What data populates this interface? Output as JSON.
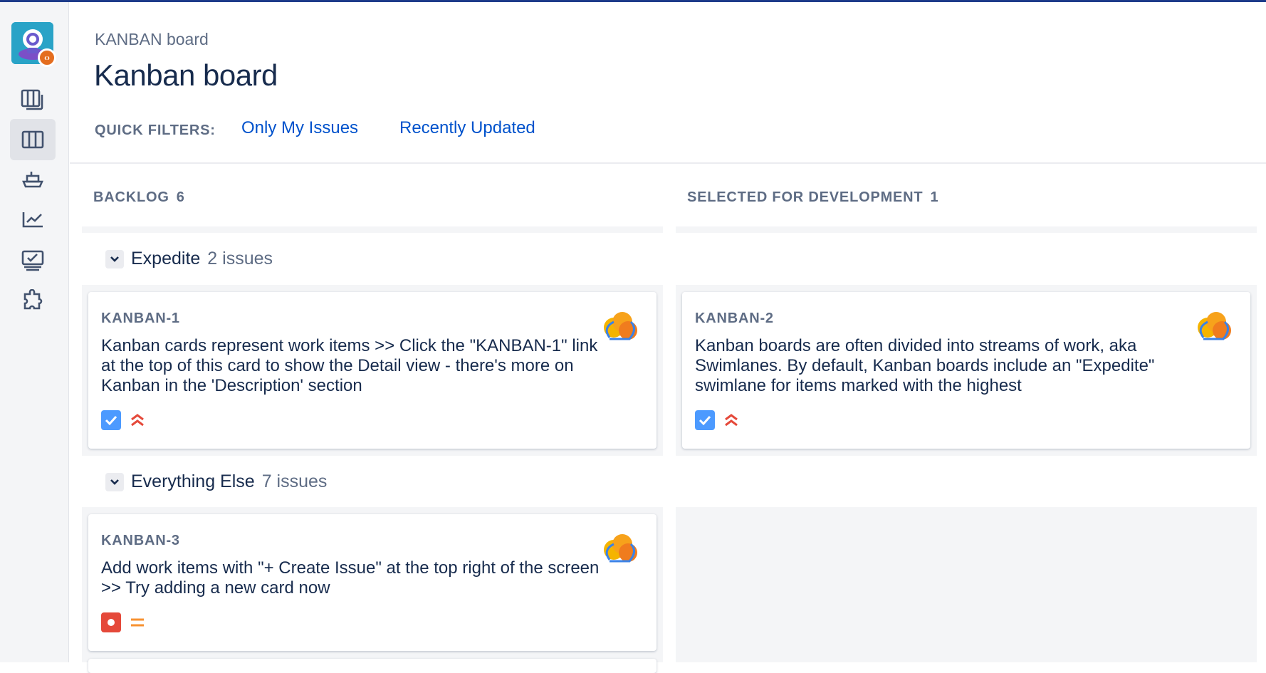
{
  "header": {
    "breadcrumb": "KANBAN board",
    "title": "Kanban board"
  },
  "quick_filters": {
    "label": "QUICK FILTERS:",
    "items": [
      "Only My Issues",
      "Recently Updated"
    ]
  },
  "sidebar": {
    "items": [
      {
        "icon": "project-avatar-icon"
      },
      {
        "icon": "backlog-icon"
      },
      {
        "icon": "board-icon",
        "active": true
      },
      {
        "icon": "releases-icon"
      },
      {
        "icon": "reports-icon"
      },
      {
        "icon": "issues-icon"
      },
      {
        "icon": "addons-icon"
      }
    ]
  },
  "columns": [
    {
      "name": "BACKLOG",
      "count": "6"
    },
    {
      "name": "SELECTED FOR DEVELOPMENT",
      "count": "1"
    }
  ],
  "swimlanes": [
    {
      "name": "Expedite",
      "count": "2 issues"
    },
    {
      "name": "Everything Else",
      "count": "7 issues"
    }
  ],
  "cards": [
    {
      "key": "KANBAN-1",
      "summary": "Kanban cards represent work items >> Click the \"KANBAN-1\" link at the top of this card to show the Detail view - there's more on Kanban in the 'Description' section",
      "type": "task",
      "priority": "highest"
    },
    {
      "key": "KANBAN-2",
      "summary": "Kanban boards are often divided into streams of work, aka Swimlanes. By default, Kanban boards include an \"Expedite\" swimlane for items marked with the highest",
      "type": "task",
      "priority": "highest"
    },
    {
      "key": "KANBAN-3",
      "summary": "Add work items with \"+ Create Issue\" at the top right of the screen >> Try adding a new card now",
      "type": "bug",
      "priority": "medium"
    }
  ],
  "colors": {
    "link": "#0052cc",
    "task": "#4c9aff",
    "bug": "#e5493a",
    "priority_high": "#e5493a",
    "priority_medium": "#f79232",
    "top_bar": "#1d3b8a"
  }
}
